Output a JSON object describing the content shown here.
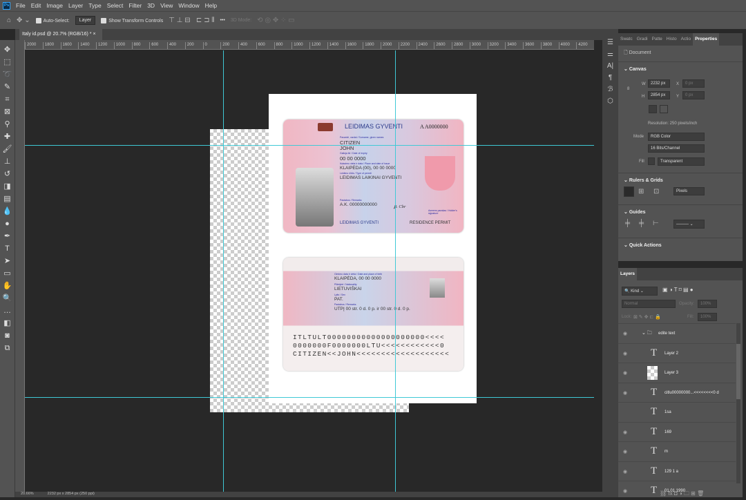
{
  "app": {
    "logo": "Ps"
  },
  "menu": [
    "File",
    "Edit",
    "Image",
    "Layer",
    "Type",
    "Select",
    "Filter",
    "3D",
    "View",
    "Window",
    "Help"
  ],
  "options": {
    "auto_select": "Auto-Select:",
    "auto_select_target": "Layer",
    "show_transform": "Show Transform Controls",
    "mode_3d": "3D Mode:",
    "more": "•••"
  },
  "document_tab": {
    "title": "Italy id.psd @ 20.7% (RGB/16) *",
    "close": "×"
  },
  "ruler": [
    "2000",
    "1800",
    "1600",
    "1400",
    "1200",
    "1000",
    "800",
    "600",
    "400",
    "200",
    "0",
    "200",
    "400",
    "600",
    "800",
    "1000",
    "1200",
    "1400",
    "1600",
    "1800",
    "2000",
    "2200",
    "2400",
    "2600",
    "2800",
    "3000",
    "3200",
    "3400",
    "3600",
    "3800",
    "4000",
    "4200"
  ],
  "card_front": {
    "title": "LEIDIMAS GYVENTI",
    "number": "A A0000000",
    "l_name": "Pavardė, vardai / Surname, given names",
    "surname": "CITIZEN",
    "given": "JOHN",
    "l_expiry": "Galioja iki / Date of expiry",
    "expiry": "00 00 0000",
    "l_issue": "Išdavimo vieta ir data / Place and date of issue",
    "issue": "KLAIPĖDA (00), 00 00 0000",
    "l_type": "Leidimo rūšis / Type of permit",
    "type": "LEIDIMAS LAIKINAI GYVENTI",
    "l_remarks": "Pastabos / Remarks",
    "remarks": "A.K. 00000000000",
    "l_sign": "Asmens parašas / Holder's signature",
    "footer_left": "LEIDIMAS GYVENTI",
    "footer_right": "RESIDENCE PERMIT"
  },
  "card_back": {
    "l_birth": "Gimimo data ir vieta / Date and place of birth",
    "birth": "KLAIPĖDA, 00 00 0000",
    "l_nat": "Pilietybė / Nationality",
    "nat": "LIETUVIŠKAI",
    "l_sex": "Lytis / Sex",
    "sex": "PAT.",
    "l_remarks": "Pastabos / Remarks",
    "remarks": "UTPĮ 00 str. 0 d. 0 p. ir 00 str. 0 d. 0 p.",
    "mrz": [
      "ITLTULT00000000000000000000<<<<",
      "0000000F0000000LTU<<<<<<<<<<<<0",
      "CITIZEN<<JOHN<<<<<<<<<<<<<<<<<<<"
    ]
  },
  "properties": {
    "tabs": [
      "Swatc",
      "Gradi",
      "Patte",
      "Histo",
      "Actio",
      "Properties"
    ],
    "doc": "Document",
    "canvas": "Canvas",
    "w_label": "W",
    "w": "2232 px",
    "h_label": "H",
    "h": "2854 px",
    "x_label": "X",
    "x": "0 px",
    "y_label": "Y",
    "y": "0 px",
    "resolution": "Resolution: 250 pixels/inch",
    "mode_label": "Mode",
    "mode": "RGB Color",
    "depth": "16 Bits/Channel",
    "fill_label": "Fill",
    "fill": "Transparent",
    "rulers": "Rulers & Grids",
    "units": "Pixels",
    "guides": "Guides",
    "quick": "Quick Actions"
  },
  "layers": {
    "title": "Layers",
    "kind": "Kind",
    "blend": "Normal",
    "opacity_label": "Opacity:",
    "opacity": "100%",
    "lock_label": "Lock:",
    "fill_label": "Fill:",
    "fill": "100%",
    "items": [
      {
        "name": "edite text",
        "type": "group"
      },
      {
        "name": "Layer 2",
        "type": "text"
      },
      {
        "name": "Layer 3",
        "type": "image"
      },
      {
        "name": "citlu00000000...<<<<<<<<0 d",
        "type": "text"
      },
      {
        "name": "1sa",
        "type": "text",
        "hidden": true
      },
      {
        "name": "169",
        "type": "text"
      },
      {
        "name": "m",
        "type": "text"
      },
      {
        "name": "129 1 a",
        "type": "text"
      },
      {
        "name": "01.01.1990",
        "type": "text"
      }
    ]
  },
  "status": {
    "zoom": "20.66%",
    "info": "2232 px x 2854 px (250 ppi)"
  },
  "colors": {
    "guide": "#3fc9d6",
    "panel": "#535353",
    "canvas_bg": "#282828"
  }
}
